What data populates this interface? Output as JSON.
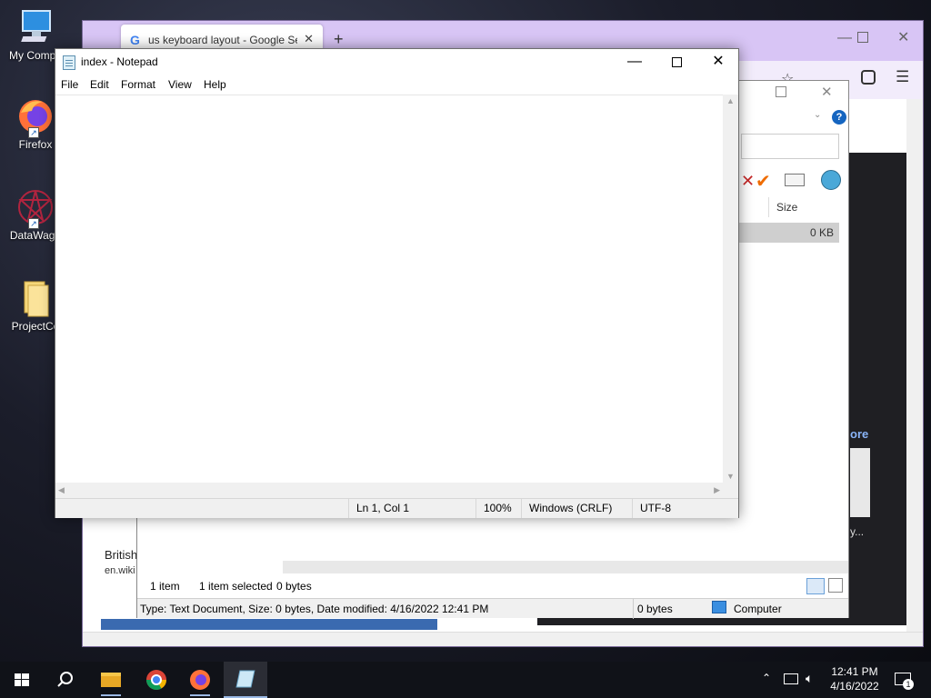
{
  "desktop": {
    "icons": [
      {
        "label": "My Compu",
        "icon": "computer-icon"
      },
      {
        "label": "Firefox",
        "icon": "firefox-icon"
      },
      {
        "label": "DataWago",
        "icon": "datawagon-icon"
      },
      {
        "label": "ProjectCo",
        "icon": "folder-icon"
      }
    ]
  },
  "firefox": {
    "tab_title": "us keyboard layout - Google Se",
    "new_tab": "+",
    "page_snippet_title": "British",
    "page_snippet_url": "en.wiki",
    "more_link": "ore",
    "ellipsis_label": "y..."
  },
  "explorer": {
    "size_header": "Size",
    "selected_size": "0 KB",
    "status_items": "1 item",
    "status_selected": "1 item selected",
    "status_bytes": "0 bytes",
    "details": "Type: Text Document, Size: 0 bytes, Date modified: 4/16/2022 12:41 PM",
    "details_size": "0 bytes",
    "details_location": "Computer"
  },
  "notepad": {
    "title": "index - Notepad",
    "menu": [
      "File",
      "Edit",
      "Format",
      "View",
      "Help"
    ],
    "content": "",
    "status": {
      "position": "Ln 1, Col 1",
      "zoom": "100%",
      "line_ending": "Windows (CRLF)",
      "encoding": "UTF-8"
    }
  },
  "taskbar": {
    "time": "12:41 PM",
    "date": "4/16/2022",
    "notification_count": "1"
  },
  "colors": {
    "firefox_tabbar": "#d8c5f5",
    "taskbar": "#101218",
    "accent_blue": "#0078d7"
  }
}
